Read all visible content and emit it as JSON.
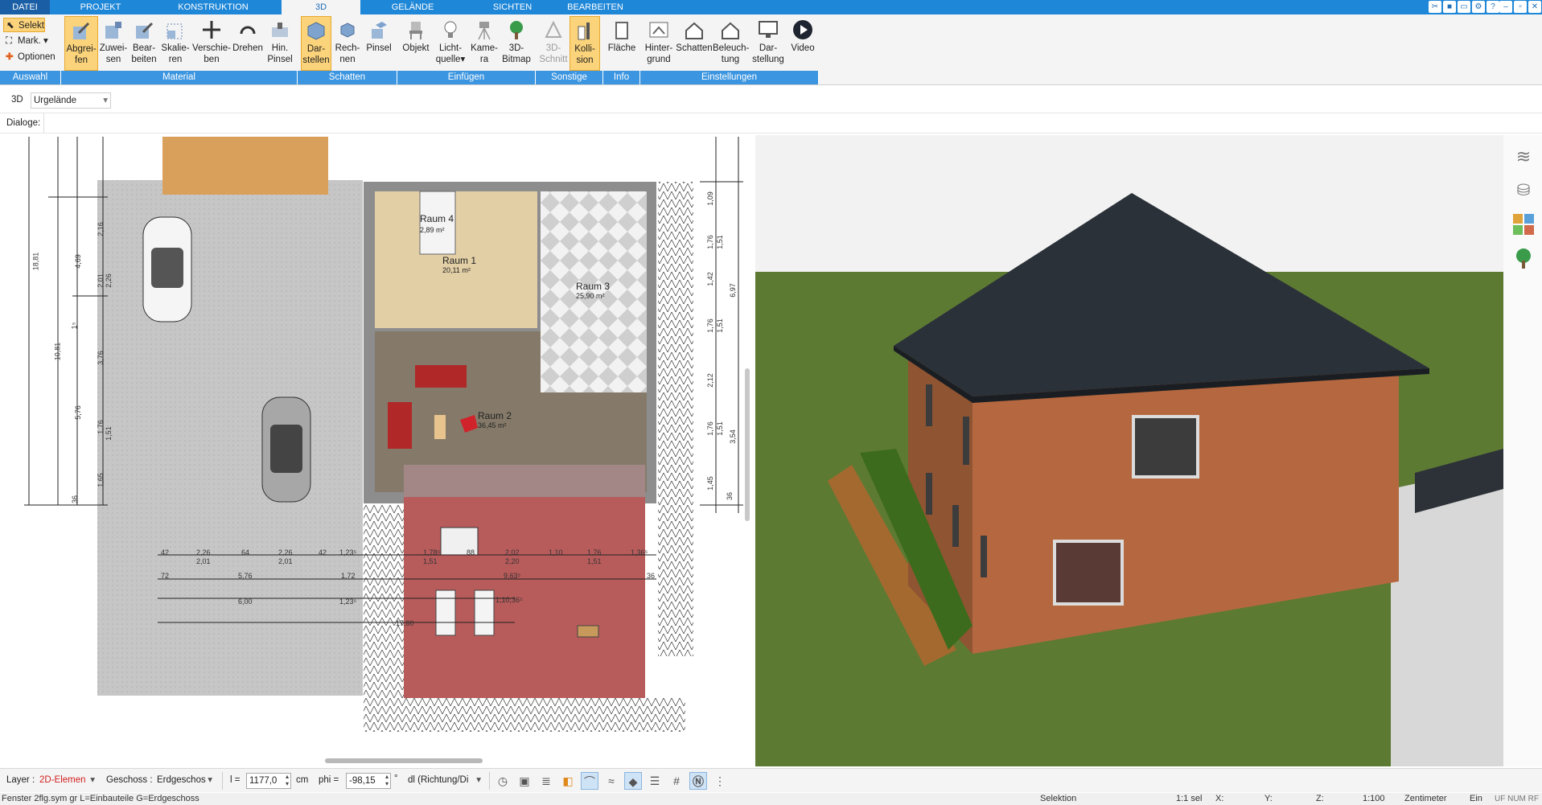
{
  "menu": {
    "tabs": [
      "DATEI",
      "PROJEKT",
      "KONSTRUKTION",
      "3D",
      "GELÄNDE",
      "SICHTEN",
      "BEARBEITEN"
    ],
    "active": "3D"
  },
  "ribbon": {
    "selekt": "Selekt",
    "mark": "Mark.",
    "optionen": "Optionen",
    "buttons": [
      {
        "l1": "Abgrei-",
        "l2": "fen"
      },
      {
        "l1": "Zuwei-",
        "l2": "sen"
      },
      {
        "l1": "Bear-",
        "l2": "beiten"
      },
      {
        "l1": "Skalie-",
        "l2": "ren"
      },
      {
        "l1": "Verschie-",
        "l2": "ben"
      },
      {
        "l1": "Drehen",
        "l2": ""
      },
      {
        "l1": "Hin.",
        "l2": "Pinsel"
      },
      {
        "l1": "Dar-",
        "l2": "stellen"
      },
      {
        "l1": "Rech-",
        "l2": "nen"
      },
      {
        "l1": "Pinsel",
        "l2": ""
      },
      {
        "l1": "Objekt",
        "l2": ""
      },
      {
        "l1": "Licht-",
        "l2": "quelle"
      },
      {
        "l1": "Kame-",
        "l2": "ra"
      },
      {
        "l1": "3D-",
        "l2": "Bitmap"
      },
      {
        "l1": "3D-",
        "l2": "Schnitt"
      },
      {
        "l1": "Kolli-",
        "l2": "sion"
      },
      {
        "l1": "Fläche",
        "l2": ""
      },
      {
        "l1": "Hinter-",
        "l2": "grund"
      },
      {
        "l1": "Schatten",
        "l2": ""
      },
      {
        "l1": "Beleuch-",
        "l2": "tung"
      },
      {
        "l1": "Dar-",
        "l2": "stellung"
      },
      {
        "l1": "Video",
        "l2": ""
      }
    ],
    "groups": [
      "Auswahl",
      "Material",
      "Schatten",
      "Einfügen",
      "Sonstige",
      "Info",
      "Einstellungen"
    ]
  },
  "row3d": {
    "label": "3D",
    "terrain_value": "Urgelände"
  },
  "dialog_label": "Dialoge:",
  "plan": {
    "rooms": [
      {
        "name": "Raum 4",
        "area": "2,89 m²"
      },
      {
        "name": "Raum 1",
        "area": "20,11 m²"
      },
      {
        "name": "Raum 3",
        "area": "25,90 m²"
      },
      {
        "name": "Raum 2",
        "area": "36,45 m²"
      }
    ],
    "dims_left": [
      "18,81",
      "10,81",
      "4,69",
      "2,01",
      "3,76",
      "5,76",
      "1,76",
      "1,65",
      "2,16",
      "2,26",
      "1⁵",
      "1,51",
      "36"
    ],
    "dims_right": [
      "1,09",
      "1,76",
      "1,51",
      "1,42",
      "6,97",
      "1,76",
      "1,51",
      "2,12",
      "1,76",
      "1,51",
      "3,54",
      "1,45",
      "36"
    ],
    "dims_bottom_row1": [
      "42",
      "2,26",
      "64",
      "2,26",
      "42",
      "1,23⁵",
      "1,78⁵",
      "88",
      "2,02",
      "1,10",
      "1,76",
      "1,36⁵"
    ],
    "dims_bottom_row2": [
      "2,01",
      "2,01",
      "1,51",
      "2,20",
      "1,51"
    ],
    "dims_bottom_row3": [
      "72",
      "5,76",
      "1,72",
      "9,63⁵",
      "36"
    ],
    "dims_bottom_row4": [
      "6,00",
      "1,23⁵",
      "1,10,36⁵"
    ],
    "dims_bottom_row5": [
      "17,60"
    ]
  },
  "bottombar": {
    "layer_label": "Layer :",
    "layer_value": "2D-Elemen",
    "geschoss_label": "Geschoss :",
    "geschoss_value": "Erdgeschos",
    "l_label": "l =",
    "l_value": "1177,0",
    "l_unit": "cm",
    "phi_label": "phi =",
    "phi_value": "-98,15",
    "phi_unit": "°",
    "dl_value": "dl (Richtung/Di"
  },
  "status": {
    "left": "Fenster 2flg.sym gr L=Einbauteile G=Erdgeschoss",
    "mode": "Selektion",
    "sel": "1:1 sel",
    "x": "X:",
    "y": "Y:",
    "z": "Z:",
    "scale": "1:100",
    "unit": "Zentimeter",
    "ein": "Ein",
    "flags": "UF  NUM  RF"
  },
  "colors": {
    "menubar": "#1f87d8",
    "group_bar": "#3b95e0",
    "selected_button": "#fbd37a",
    "wall_brown": "#b5683f",
    "roof": "#2b3138",
    "grass": "#5d7a33"
  }
}
